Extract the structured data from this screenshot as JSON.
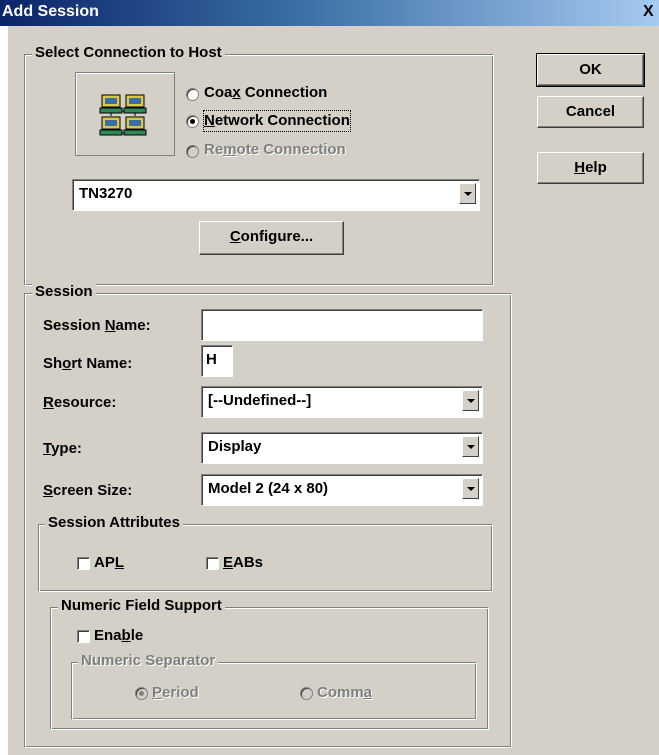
{
  "window": {
    "title": "Add Session",
    "close_glyph": "X"
  },
  "buttons": {
    "ok": "OK",
    "cancel": "Cancel",
    "help_u": "H",
    "help_rest": "elp"
  },
  "connection_group": {
    "legend": "Select Connection to Host",
    "icon": "network-computers-icon",
    "options": {
      "coax": {
        "pre": "Coa",
        "u": "x",
        "post": " Connection",
        "selected": false,
        "enabled": true
      },
      "network": {
        "pre": "",
        "u": "N",
        "post": "etwork Connection",
        "selected": true,
        "enabled": true
      },
      "remote": {
        "pre": "Re",
        "u": "m",
        "post": "ote Connection",
        "selected": false,
        "enabled": false
      }
    },
    "connection_type": "TN3270",
    "configure_u": "C",
    "configure_rest": "onfigure..."
  },
  "session_group": {
    "legend": "Session",
    "session_name": {
      "pre": "Session ",
      "u": "N",
      "post": "ame:",
      "value": ""
    },
    "short_name": {
      "pre": "Sh",
      "u": "o",
      "post": "rt Name:",
      "value": "H"
    },
    "resource": {
      "pre": "",
      "u": "R",
      "post": "esource:",
      "value": "[--Undefined--]"
    },
    "type": {
      "pre": "",
      "u": "T",
      "post": "ype:",
      "value": "Display"
    },
    "screen_size": {
      "pre": "",
      "u": "S",
      "post": "creen Size:",
      "value": "Model 2 (24 x 80)"
    }
  },
  "attributes_group": {
    "legend": "Session Attributes",
    "apl": {
      "pre": "AP",
      "u": "L",
      "post": "",
      "checked": false
    },
    "eabs": {
      "pre": "",
      "u": "E",
      "post": "ABs",
      "checked": false
    }
  },
  "numeric_group": {
    "legend": "Numeric Field Support",
    "enable": {
      "pre": "Ena",
      "u": "b",
      "post": "le",
      "checked": false
    },
    "separator_legend": "Numeric Separator",
    "period": {
      "pre": "",
      "u": "P",
      "post": "eriod",
      "selected": true
    },
    "comma": {
      "pre": "Comm",
      "u": "a",
      "post": "",
      "selected": false
    }
  }
}
